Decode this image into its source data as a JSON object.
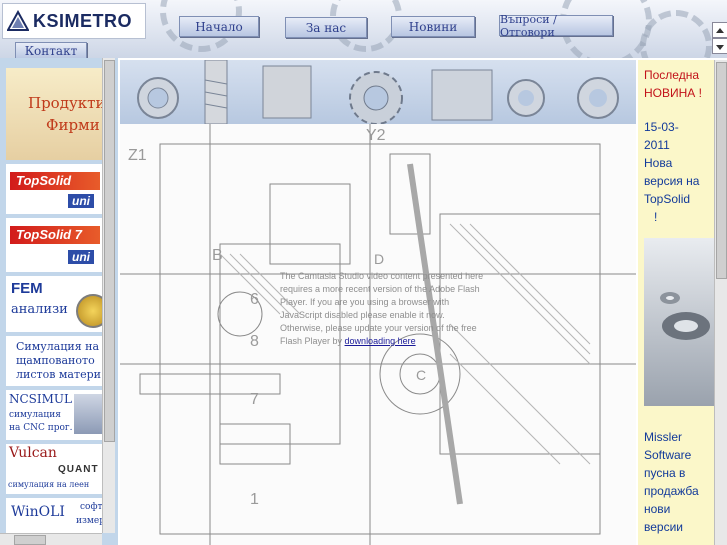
{
  "header": {
    "logo_text": "KSIMETRO",
    "nav": [
      {
        "label": "Начало"
      },
      {
        "label": "За нас"
      },
      {
        "label": "Новини"
      },
      {
        "label": "Въпроси / Отговори"
      },
      {
        "label": "Контакт"
      }
    ]
  },
  "left_panel": {
    "heading_line1": "Продукти",
    "heading_line2": "Фирми",
    "items": [
      {
        "title": "TopSolid",
        "subtitle": "uni"
      },
      {
        "title": "TopSolid 7",
        "subtitle": "uni"
      },
      {
        "title": "FEM",
        "subtitle": "анализи"
      },
      {
        "title": "Симулация на",
        "line2": "щампованото",
        "line3": "листов матери"
      },
      {
        "title": "NCSIMUL",
        "line2": "симулация",
        "line3": "на CNC прог."
      },
      {
        "title": "Vulcan",
        "line2": "QUANT",
        "line3": "симулация на леен"
      },
      {
        "title": "WinOLI",
        "line2": "софту",
        "line3": "измер"
      }
    ]
  },
  "main": {
    "flash_message": "The Camtasia Studio video content presented here requires a more recent version of the Adobe Flash Player. If you are you using a browser with JavaScript disabled please enable it now. Otherwise, please update your version of the free Flash Player by",
    "flash_link": "downloading here",
    "drawing_labels": [
      "Z1",
      "Y2",
      "B",
      "6",
      "8",
      "7",
      "1",
      "C",
      "D"
    ]
  },
  "right_panel": {
    "news1_line1": "Последна",
    "news1_line2": "НОВИНА !",
    "news2_date": "15-03-",
    "news2_year": "2011",
    "news2_l1": "Нова",
    "news2_l2": "версия на",
    "news2_l3": "TopSolid",
    "news2_l4": "!",
    "news3_l1": "Missler",
    "news3_l2": "Software",
    "news3_l3": "пусна в",
    "news3_l4": "продажба",
    "news3_l5": "нови",
    "news3_l6": "версии"
  },
  "colors": {
    "nav_text": "#2e3f8c",
    "heading_red": "#c03a1a",
    "news_bg": "#fbf7c9",
    "news_text": "#123a9a",
    "news_red": "#c2121a"
  }
}
